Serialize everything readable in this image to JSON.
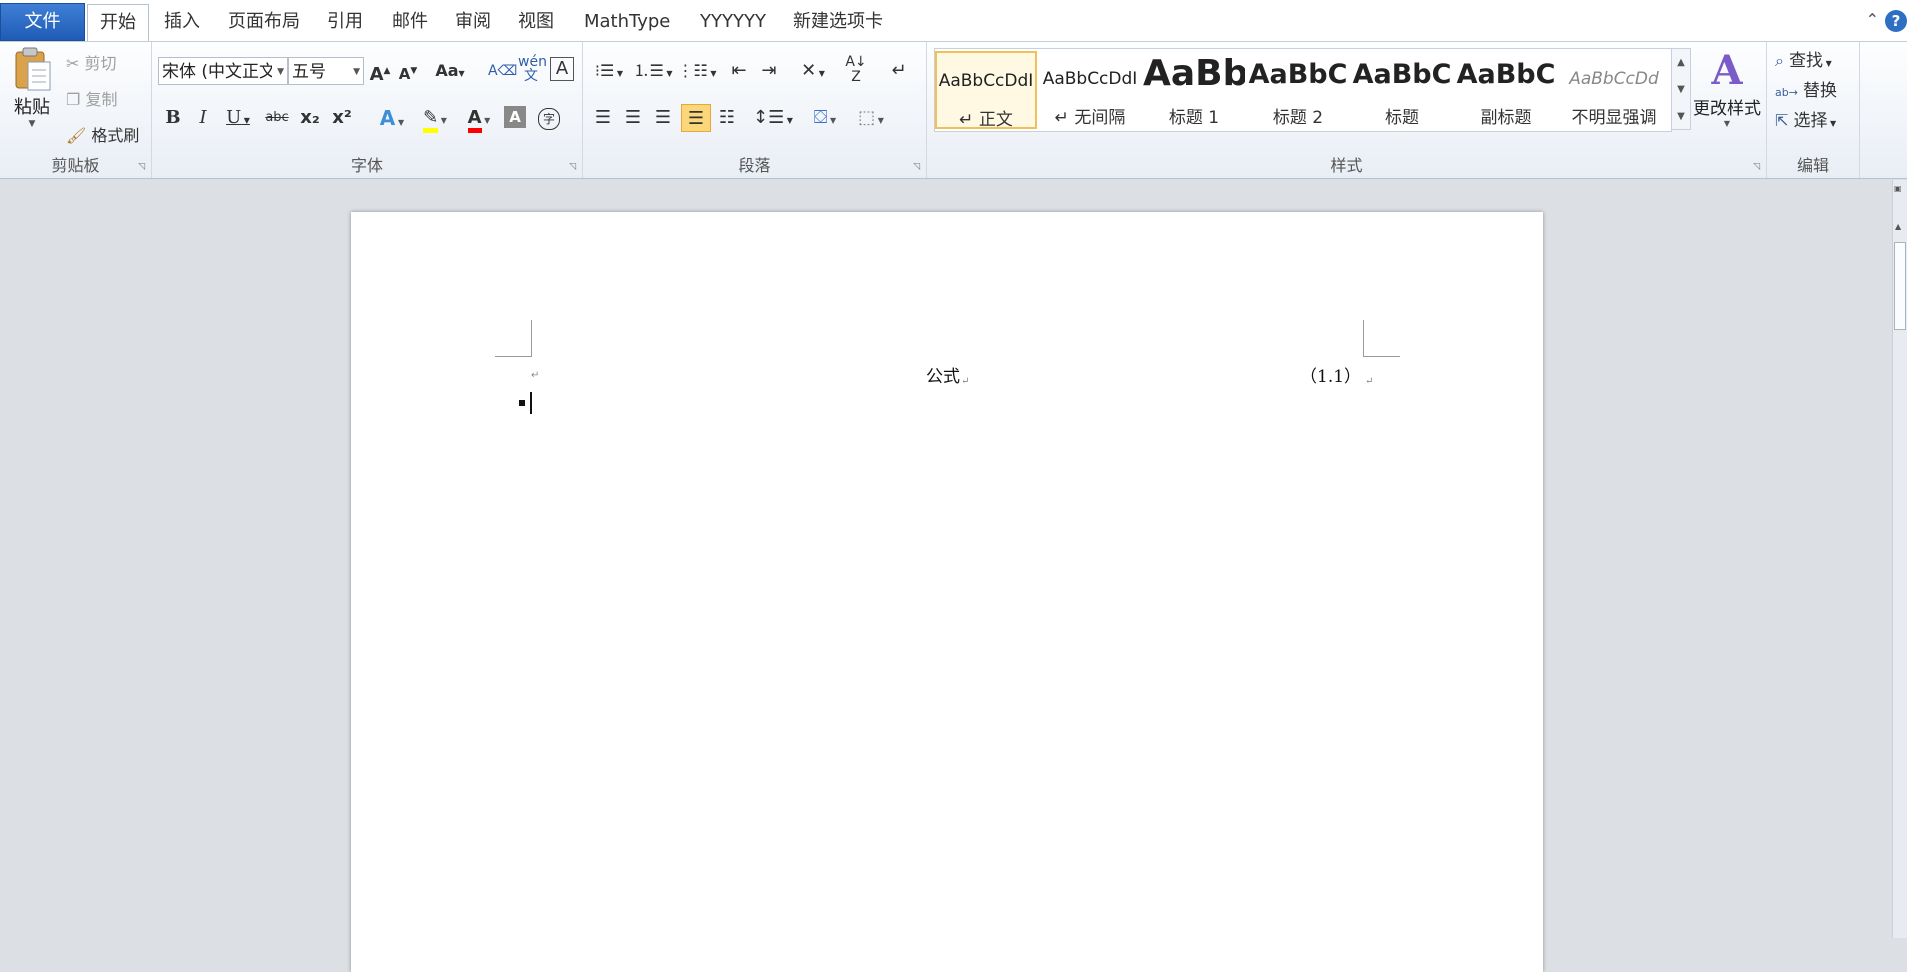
{
  "tabs": {
    "file": "文件",
    "home": "开始",
    "insert": "插入",
    "page_layout": "页面布局",
    "references": "引用",
    "mailings": "邮件",
    "review": "审阅",
    "view": "视图",
    "mathtype": "MathType",
    "yyyyyy": "YYYYYY",
    "new_tab": "新建选项卡"
  },
  "clipboard": {
    "paste": "粘贴",
    "cut": "剪切",
    "copy": "复制",
    "format_painter": "格式刷",
    "label": "剪贴板"
  },
  "font": {
    "font_name": "宋体 (中文正文",
    "font_size": "五号",
    "label": "字体",
    "grow": "A",
    "shrink": "A",
    "change_case": "Aa",
    "bold": "B",
    "italic": "I",
    "underline": "U",
    "strike": "abc",
    "subscript": "x₂",
    "superscript": "x²"
  },
  "paragraph": {
    "label": "段落"
  },
  "styles": {
    "label": "样式",
    "items": [
      {
        "sample": "AaBbCcDdI",
        "name": "↵ 正文"
      },
      {
        "sample": "AaBbCcDdI",
        "name": "↵ 无间隔"
      },
      {
        "sample": "AaBb",
        "name": "标题 1"
      },
      {
        "sample": "AaBbC",
        "name": "标题 2"
      },
      {
        "sample": "AaBbC",
        "name": "标题"
      },
      {
        "sample": "AaBbC",
        "name": "副标题"
      },
      {
        "sample": "AaBbCcDd",
        "name": "不明显强调"
      }
    ],
    "change_styles": "更改样式"
  },
  "editing": {
    "label": "编辑",
    "find": "查找",
    "replace": "替换",
    "select": "选择"
  },
  "document": {
    "formula_text": "公式",
    "equation_number": "（1.1）"
  },
  "colors": {
    "file_tab": "#2a66c0",
    "highlight": "#ffff00",
    "font_color": "#ff0000",
    "selected_button": "#fbd77a"
  }
}
